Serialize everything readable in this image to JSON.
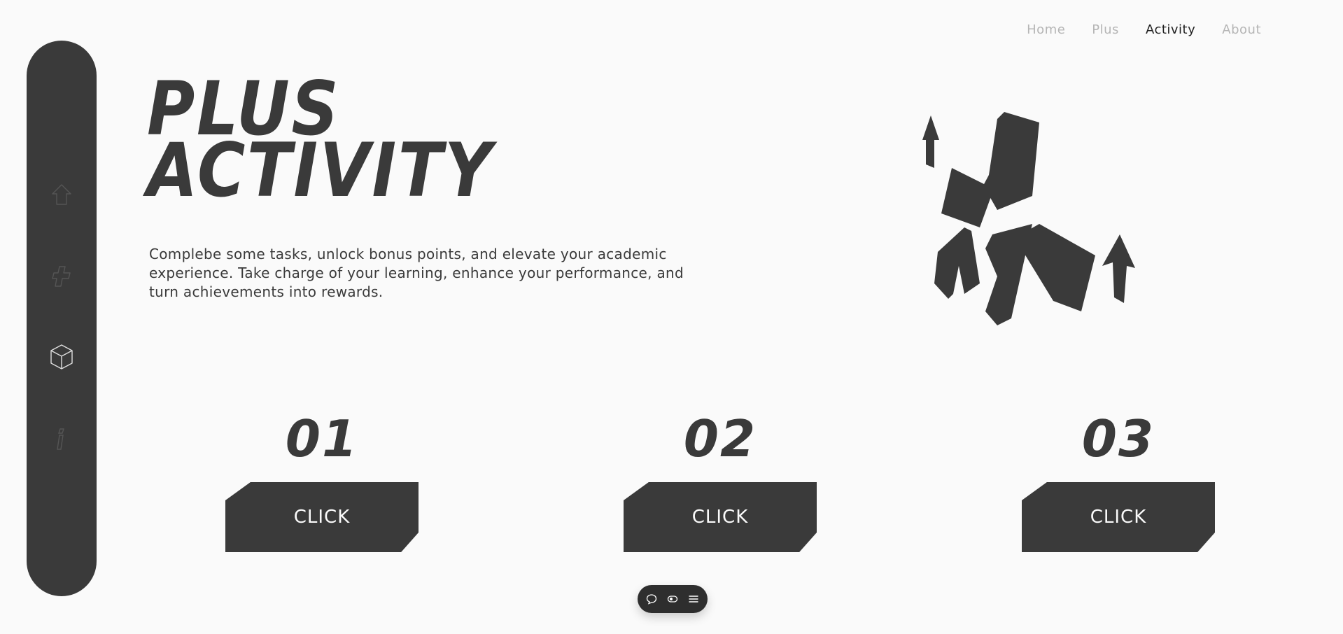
{
  "nav": {
    "items": [
      {
        "label": "Home",
        "active": false
      },
      {
        "label": "Plus",
        "active": false
      },
      {
        "label": "Activity",
        "active": true
      },
      {
        "label": "About",
        "active": false
      }
    ]
  },
  "sidebar": {
    "icons": [
      "home-icon",
      "plus-icon",
      "cube-icon",
      "info-icon"
    ]
  },
  "hero": {
    "title_line1": "PLUS",
    "title_line2": "ACTIVITY",
    "description": "Complebe some tasks, unlock bonus points, and elevate your academic experience. Take charge of your learning, enhance your performance, and turn achievements into rewards."
  },
  "steps": [
    {
      "number": "01",
      "button_label": "CLICK"
    },
    {
      "number": "02",
      "button_label": "CLICK"
    },
    {
      "number": "03",
      "button_label": "CLICK"
    }
  ],
  "toolbar": {
    "icons": [
      "comment-icon",
      "toggle-icon",
      "menu-icon"
    ]
  },
  "colors": {
    "background": "#fafafa",
    "primary": "#3a3a3a",
    "nav_inactive": "#b5b5b5",
    "nav_active": "#1f1f1f"
  }
}
